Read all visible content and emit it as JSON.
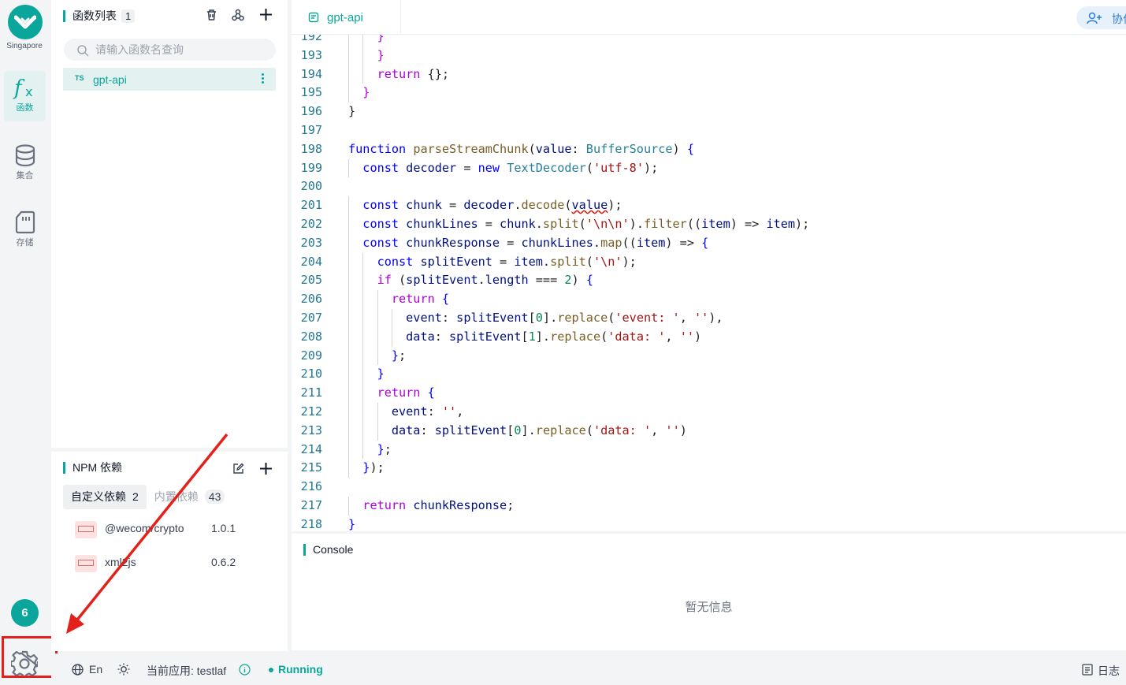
{
  "app": {
    "region": "Singapore",
    "accent": "#0aa69b"
  },
  "rail": {
    "items": [
      {
        "label": "函数",
        "icon": "function-icon",
        "active": true
      },
      {
        "label": "集合",
        "icon": "database-icon",
        "active": false
      },
      {
        "label": "存储",
        "icon": "storage-card-icon",
        "active": false
      }
    ],
    "notification_count": "6"
  },
  "functions": {
    "title": "函数列表",
    "count": "1",
    "search_placeholder": "请输入函数名查询",
    "items": [
      {
        "lang": "TS",
        "name": "gpt-api"
      }
    ]
  },
  "npm": {
    "title": "NPM 依赖",
    "tabs": [
      {
        "label": "自定义依赖",
        "count": "2"
      },
      {
        "label": "内置依赖",
        "count": "43"
      }
    ],
    "deps": [
      {
        "name": "@wecom/crypto",
        "version": "1.0.1"
      },
      {
        "name": "xml2js",
        "version": "0.6.2"
      }
    ]
  },
  "editor": {
    "tab": "gpt-api",
    "collab_label": "协作",
    "lines": [
      {
        "n": "192",
        "html": "    <span class=\"kt\">}</span>"
      },
      {
        "n": "193",
        "html": "    <span class=\"kt\">}</span>"
      },
      {
        "n": "194",
        "html": "    <span class=\"kt\">return</span> {};"
      },
      {
        "n": "195",
        "html": "  <span class=\"kt\">}</span>"
      },
      {
        "n": "196",
        "html": "}"
      },
      {
        "n": "197",
        "html": ""
      },
      {
        "n": "198",
        "html": "<span class=\"kw\">function</span> <span class=\"fn\">parseStreamChunk</span>(<span class=\"vr\">value</span>: <span class=\"ty\">BufferSource</span>) <span class=\"kw\">{</span>"
      },
      {
        "n": "199",
        "html": "  <span class=\"kw\">const</span> <span class=\"vr\">decoder</span> = <span class=\"kw\">new</span> <span class=\"ty\">TextDecoder</span>(<span class=\"st\">'utf-8'</span>);"
      },
      {
        "n": "200",
        "html": ""
      },
      {
        "n": "201",
        "html": "  <span class=\"kw\">const</span> <span class=\"vr\">chunk</span> = <span class=\"vr\">decoder</span>.<span class=\"fn\">decode</span>(<span class=\"vr squig\">value</span>);"
      },
      {
        "n": "202",
        "html": "  <span class=\"kw\">const</span> <span class=\"vr\">chunkLines</span> = <span class=\"vr\">chunk</span>.<span class=\"fn\">split</span>(<span class=\"st\">'\\n\\n'</span>).<span class=\"fn\">filter</span>((<span class=\"vr\">item</span>) => <span class=\"vr\">item</span>);"
      },
      {
        "n": "203",
        "html": "  <span class=\"kw\">const</span> <span class=\"vr\">chunkResponse</span> = <span class=\"vr\">chunkLines</span>.<span class=\"fn\">map</span>((<span class=\"vr\">item</span>) => <span class=\"kw\">{</span>"
      },
      {
        "n": "204",
        "html": "    <span class=\"kw\">const</span> <span class=\"vr\">splitEvent</span> = <span class=\"vr\">item</span>.<span class=\"fn\">split</span>(<span class=\"st\">'\\n'</span>);"
      },
      {
        "n": "205",
        "html": "    <span class=\"kt\">if</span> (<span class=\"vr\">splitEvent</span>.<span class=\"vr\">length</span> === <span class=\"nu\">2</span>) <span class=\"kw\">{</span>"
      },
      {
        "n": "206",
        "html": "      <span class=\"kt\">return</span> <span class=\"kw\">{</span>"
      },
      {
        "n": "207",
        "html": "        <span class=\"vr\">event</span>: <span class=\"vr\">splitEvent</span>[<span class=\"nu\">0</span>].<span class=\"fn\">replace</span>(<span class=\"st\">'event: '</span>, <span class=\"st\">''</span>),"
      },
      {
        "n": "208",
        "html": "        <span class=\"vr\">data</span>: <span class=\"vr\">splitEvent</span>[<span class=\"nu\">1</span>].<span class=\"fn\">replace</span>(<span class=\"st\">'data: '</span>, <span class=\"st\">''</span>)"
      },
      {
        "n": "209",
        "html": "      <span class=\"kw\">}</span>;"
      },
      {
        "n": "210",
        "html": "    <span class=\"kw\">}</span>"
      },
      {
        "n": "211",
        "html": "    <span class=\"kt\">return</span> <span class=\"kw\">{</span>"
      },
      {
        "n": "212",
        "html": "      <span class=\"vr\">event</span>: <span class=\"st\">''</span>,"
      },
      {
        "n": "213",
        "html": "      <span class=\"vr\">data</span>: <span class=\"vr\">splitEvent</span>[<span class=\"nu\">0</span>].<span class=\"fn\">replace</span>(<span class=\"st\">'data: '</span>, <span class=\"st\">''</span>)"
      },
      {
        "n": "214",
        "html": "    <span class=\"kw\">}</span>;"
      },
      {
        "n": "215",
        "html": "  <span class=\"kw\">}</span>);"
      },
      {
        "n": "216",
        "html": ""
      },
      {
        "n": "217",
        "html": "  <span class=\"kt\">return</span> <span class=\"vr\">chunkResponse</span>;"
      },
      {
        "n": "218",
        "html": "<span class=\"kw\">}</span>"
      }
    ]
  },
  "console": {
    "title": "Console",
    "empty_text": "暂无信息"
  },
  "statusbar": {
    "language": "En",
    "current_app_label": "当前应用: testlaf",
    "status": "Running",
    "log_label": "日志"
  },
  "annotation": {
    "color": "#e32019",
    "target": "settings-gear"
  }
}
